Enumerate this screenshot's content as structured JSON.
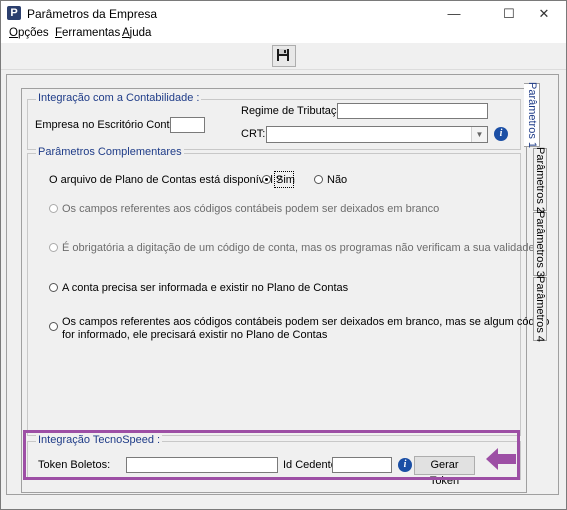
{
  "window": {
    "title": "Parâmetros da Empresa",
    "icon_letter": "P",
    "controls": {
      "minimize": "—",
      "maximize": "☐",
      "close": "✕"
    }
  },
  "menu": {
    "opcoes_prefix": "O",
    "opcoes_rest": "pções",
    "ferramentas_prefix": "F",
    "ferramentas_rest": "erramentas",
    "ajuda_prefix": "A",
    "ajuda_rest": "juda"
  },
  "toolbar": {
    "save_icon": "floppy-disk-icon"
  },
  "contabilidade": {
    "legend": "Integração com a Contabilidade :",
    "empresa_label": "Empresa no Escritório Contábil:",
    "empresa_value": "",
    "regime_label": "Regime de Tributação:",
    "regime_value": "",
    "crt_label": "CRT:",
    "crt_value": ""
  },
  "complementares": {
    "legend": "Parâmetros Complementares",
    "plano_question": "O arquivo de Plano de Contas está disponível ?",
    "sim_label": "Sim",
    "nao_label": "Não",
    "options": [
      "Os campos referentes aos códigos contábeis podem ser deixados em branco",
      "É obrigatória a digitação de um código de conta, mas os programas não verificam a sua validade",
      "A conta precisa ser informada e existir no Plano de Contas",
      "Os campos referentes aos códigos contábeis podem ser deixados em branco, mas se algum código",
      "for informado, ele precisará existir no Plano de Contas"
    ]
  },
  "tecnospeed": {
    "legend": "Integração TecnoSpeed :",
    "token_label": "Token Boletos:",
    "token_value": "",
    "cedente_label": "Id Cedente:",
    "cedente_value": "",
    "gerar_button": "Gerar Token"
  },
  "tabs": [
    "Parâmetros 1",
    "Parâmetros 2",
    "Parâmetros 3",
    "Parâmetros 4"
  ],
  "colors": {
    "highlight": "#9d4fa5",
    "legend": "#1f3c88",
    "info": "#1b4fa5"
  }
}
